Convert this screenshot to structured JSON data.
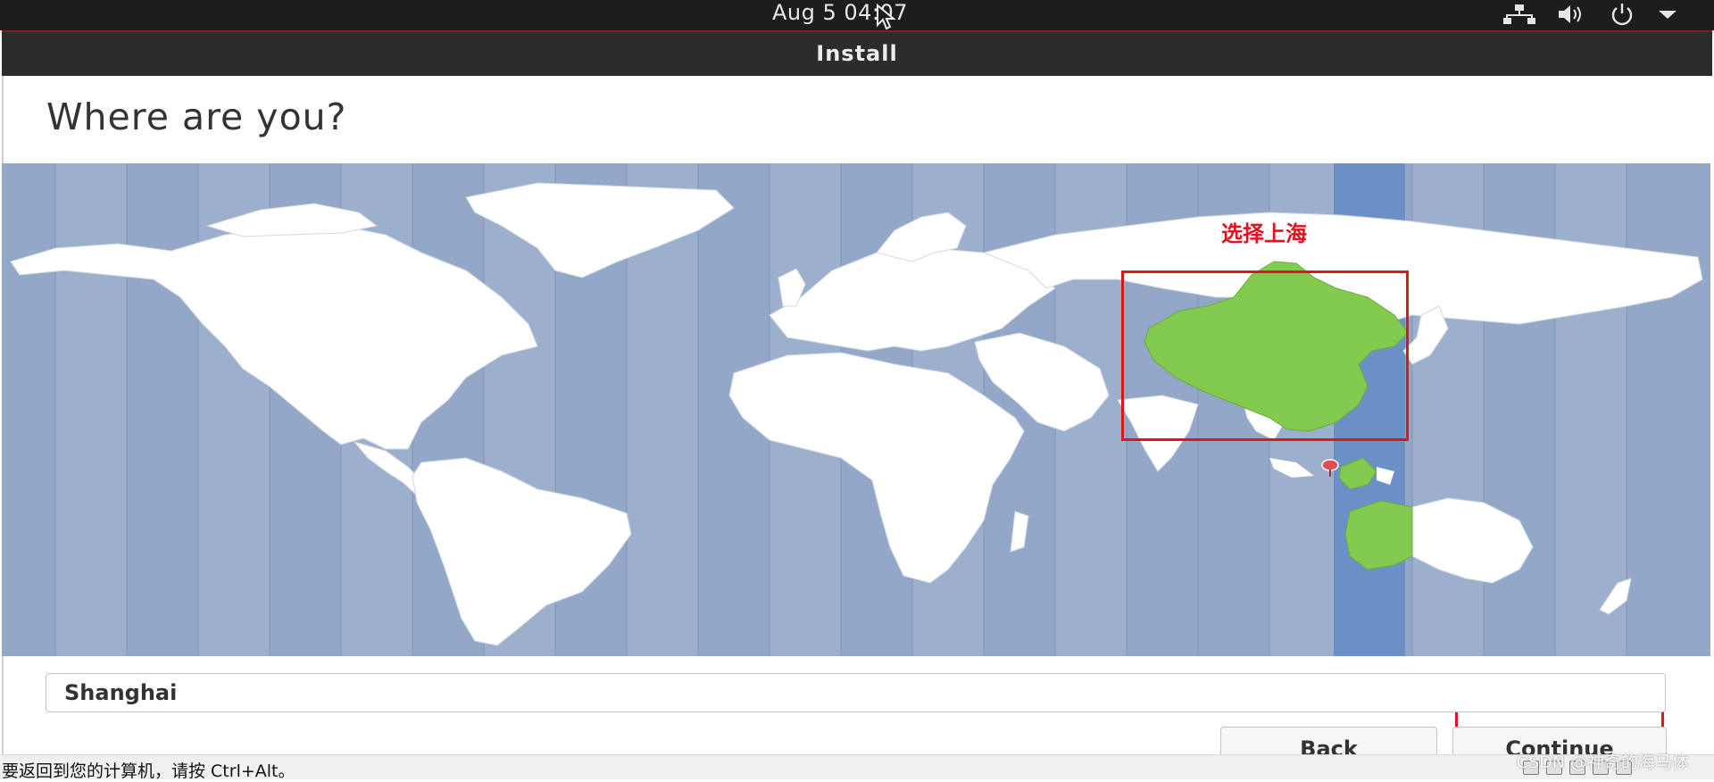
{
  "topbar": {
    "clock": "Aug 5  04:07",
    "icons": [
      "network-icon",
      "volume-icon",
      "power-icon",
      "menu-down-icon"
    ]
  },
  "window": {
    "title": "Install"
  },
  "page": {
    "heading": "Where are you?"
  },
  "map": {
    "ocean_color": "#93a8c8",
    "land_color": "#ffffff",
    "highlight_color": "#82cb4f",
    "selected_band_color": "#6b90c6",
    "marker_color": "#e05050"
  },
  "timezone": {
    "value": "Shanghai"
  },
  "buttons": {
    "back": "Back",
    "continue": "Continue"
  },
  "annotation": {
    "text": "选择上海",
    "color": "#e0141c"
  },
  "statusbar": {
    "message": "要返回到您的计算机，请按 Ctrl+Alt。"
  },
  "watermark": {
    "text": "CSDN @神奇的海马体"
  }
}
